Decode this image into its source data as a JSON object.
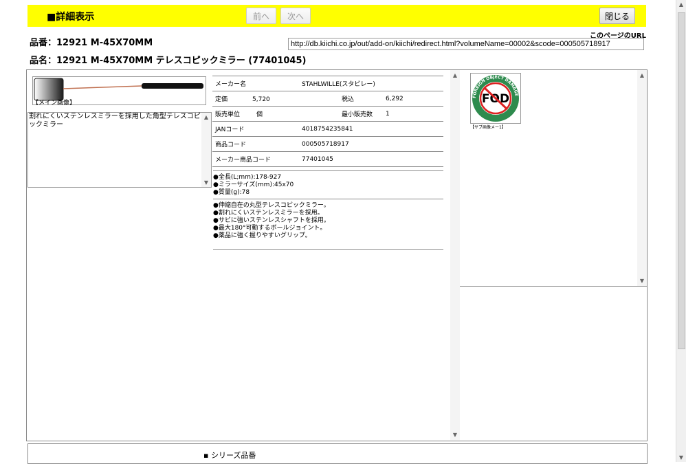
{
  "header": {
    "title": "■詳細表示",
    "prev_label": "前へ",
    "next_label": "次へ",
    "close_label": "閉じる"
  },
  "product": {
    "hinban": "品番：12921 M-45X70MM",
    "hinmei": "品名：12921 M-45X70MM テレスコピックミラー (77401045)"
  },
  "url": {
    "label": "このページのURL",
    "value": "http://db.kiichi.co.jp/out/add-on/kiichi/redirect.html?volumeName=00002&scode=000505718917"
  },
  "main_image": {
    "caption": "【メイン画像】"
  },
  "description": "割れにくいステンレスミラーを採用した角型テレスコピックミラー",
  "spec": {
    "maker_label": "メーカー名",
    "maker_value": "STAHLWILLE(スタビレー)",
    "list_price_label": "定価",
    "list_price_value": "5,720",
    "tax_label": "税込",
    "tax_value": "6,292",
    "unit_label": "販売単位",
    "unit_value": "個",
    "min_label": "最小販売数",
    "min_value": "1",
    "jan_label": "JANコード",
    "jan_value": "4018754235841",
    "code_label": "商品コード",
    "code_value": "000505718917",
    "maker_code_label": "メーカー商品コード",
    "maker_code_value": "77401045"
  },
  "spec_notes": [
    "●全長(L;mm):178-927",
    "●ミラーサイズ(mm):45x70",
    "●質量(g):78"
  ],
  "features": [
    "●伸縮自在の丸型テレスコピックミラー。",
    "●割れにくいステンレスミラーを採用。",
    "●サビに強いステンレスシャフトを採用。",
    "●最大180°可動するボールジョイント。",
    "●薬品に強く握りやすいグリップ。"
  ],
  "sub_image": {
    "caption": "【サブ画像メー1】",
    "logo_text": "FOD",
    "logo_ring_text": "FOREIGN OBJECT DAMAGE"
  },
  "series": {
    "label": "シリーズ品番"
  }
}
